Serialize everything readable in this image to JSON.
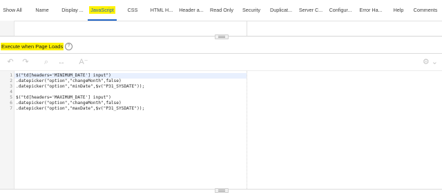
{
  "tabs": [
    {
      "label": "Show All",
      "active": false
    },
    {
      "label": "Name",
      "active": false
    },
    {
      "label": "Display ...",
      "active": false
    },
    {
      "label": "JavaScript",
      "active": true
    },
    {
      "label": "CSS",
      "active": false
    },
    {
      "label": "HTML H...",
      "active": false
    },
    {
      "label": "Header a...",
      "active": false
    },
    {
      "label": "Read Only",
      "active": false
    },
    {
      "label": "Security",
      "active": false
    },
    {
      "label": "Duplicat...",
      "active": false
    },
    {
      "label": "Server C...",
      "active": false
    },
    {
      "label": "Configur...",
      "active": false
    },
    {
      "label": "Error Ha...",
      "active": false
    },
    {
      "label": "Help",
      "active": false
    },
    {
      "label": "Comments",
      "active": false
    }
  ],
  "section": {
    "label": "Execute when Page Loads",
    "help_icon": "?"
  },
  "toolbar": {
    "undo_icon": "↶",
    "redo_icon": "↷",
    "search_icon": "⌕",
    "replace_icon": "↔",
    "font_icon": "A⁻",
    "settings_icon": "⚙ ⌄"
  },
  "code": {
    "line_numbers": [
      "1",
      "2",
      "3",
      "4",
      "5",
      "6",
      "7"
    ],
    "lines": [
      "$(\"td[headers='MINIMUM_DATE'] input\")",
      ".datepicker(\"option\",\"changeMonth\",false)",
      ".datepicker(\"option\",\"minDate\",$v(\"P31_SYSDATE\"));",
      "",
      "$(\"td[headers='MAXIMUM_DATE'] input\")",
      ".datepicker(\"option\",\"changeMonth\",false)",
      ".datepicker(\"option\",\"maxDate\",$v(\"P31_SYSDATE\"));"
    ]
  },
  "colors": {
    "highlight": "#fff200",
    "accent": "#1d62c6"
  }
}
